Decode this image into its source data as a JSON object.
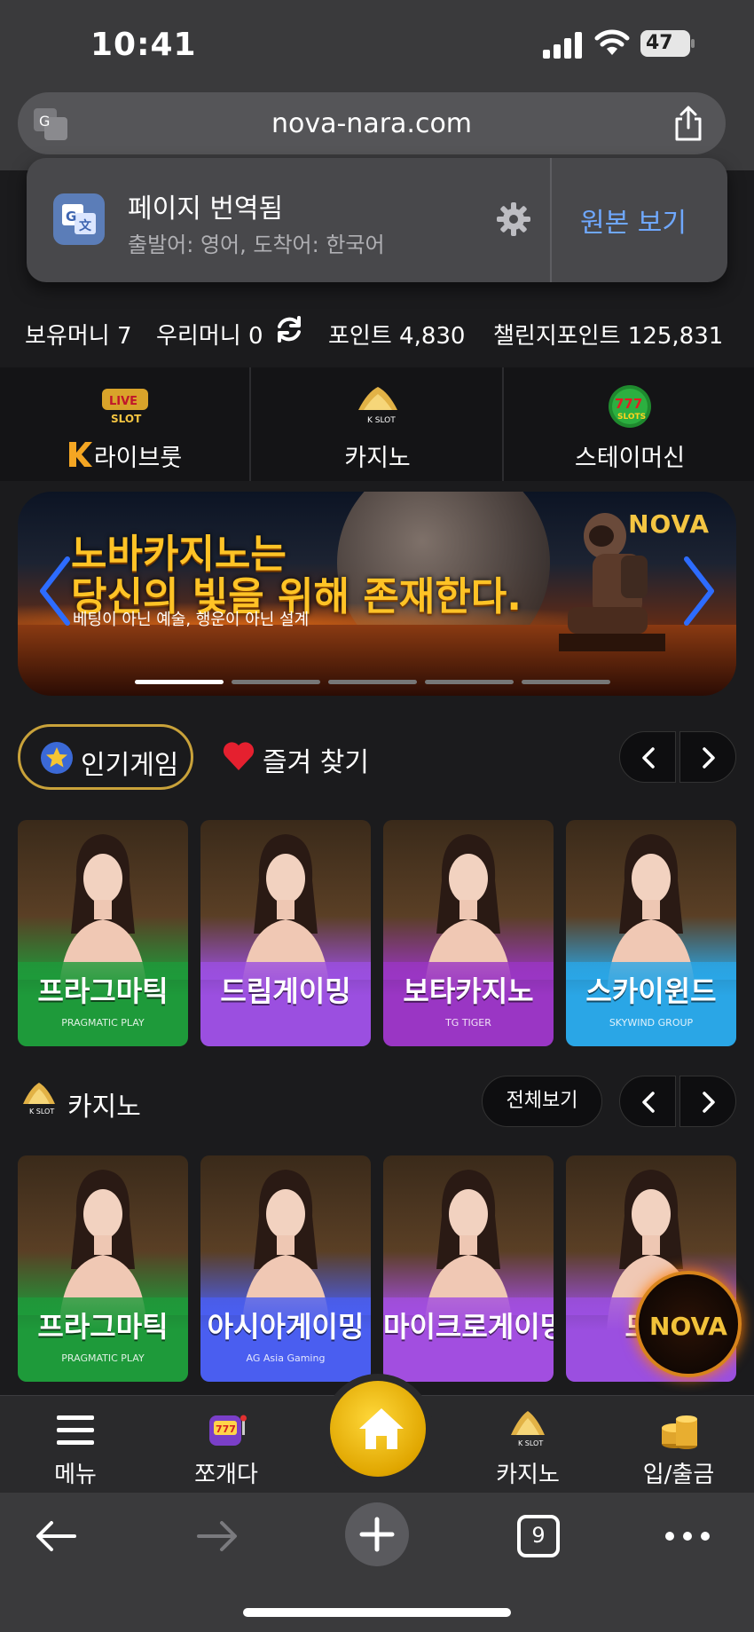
{
  "status_bar": {
    "time": "10:41",
    "battery": "47"
  },
  "browser": {
    "url": "nova-nara.com",
    "tabs_count": "9"
  },
  "translate_popup": {
    "title": "페이지 번역됨",
    "subtitle": "출발어: 영어, 도착어: 한국어",
    "show_original": "원본 보기"
  },
  "balance": {
    "owned_money": "보유머니 7",
    "woori_money": "우리머니 0",
    "points": "포인트 4,830",
    "challenge_points": "챌린지포인트 125,831"
  },
  "categories": [
    {
      "label": "라이브룻",
      "icon": "live-slot-icon"
    },
    {
      "label": "카지노",
      "icon": "k-slot-crown-icon"
    },
    {
      "label": "스테이머신",
      "icon": "777-slots-icon"
    }
  ],
  "banner": {
    "headline_1": "노바카지노는",
    "headline_2": "당신의 빛을 위해 존재한다.",
    "subtext": "베팅이 아닌 예술, 행운이 아닌 설계",
    "logo": "NOVA",
    "slide_count": 5,
    "active_slide": 1
  },
  "popular_section": {
    "popular_label": "인기게임",
    "favorites_label": "즐겨 찾기"
  },
  "popular_games": [
    {
      "name": "프라그마틱",
      "brand": "PRAGMATIC PLAY",
      "color": "#1e9a3a"
    },
    {
      "name": "드림게이밍",
      "brand": "",
      "color": "#9b4fe0"
    },
    {
      "name": "보타카지노",
      "brand": "TG TIGER",
      "color": "#9a36c4"
    },
    {
      "name": "스카이윈드",
      "brand": "SKYWIND GROUP",
      "color": "#2aa6e6"
    }
  ],
  "casino_section": {
    "title": "카지노",
    "see_all": "전체보기"
  },
  "casino_games": [
    {
      "name": "프라그마틱",
      "brand": "PRAGMATIC PLAY",
      "color": "#1e9a3a"
    },
    {
      "name": "아시아게이밍",
      "brand": "AG Asia Gaming",
      "color": "#4a5ef0"
    },
    {
      "name": "마이크로게이밍",
      "brand": "",
      "color": "#a24ee0"
    },
    {
      "name": "드림",
      "brand": "",
      "color": "#9b4fe0"
    }
  ],
  "floating_badge": "NOVA",
  "bottom_nav": {
    "menu": "메뉴",
    "jjogaeda": "쪼개다",
    "casino": "카지노",
    "deposit": "입/출금"
  }
}
